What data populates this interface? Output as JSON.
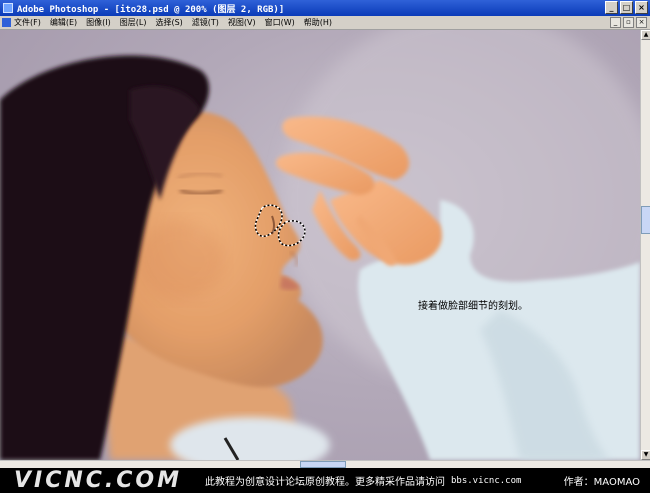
{
  "window": {
    "title": "Adobe Photoshop - [ito28.psd @ 200% (图层 2, RGB)]",
    "minimize": "_",
    "maximize": "□",
    "close": "×"
  },
  "menu": {
    "items": [
      "文件(F)",
      "编辑(E)",
      "图像(I)",
      "图层(L)",
      "选择(S)",
      "滤镜(T)",
      "视图(V)",
      "窗口(W)",
      "帮助(H)"
    ]
  },
  "canvas": {
    "caption": "接着做脸部细节的刻划。"
  },
  "footer": {
    "logo": "VICNC.COM",
    "description": "此教程为创意设计论坛原创教程。更多精采作品请访问",
    "url": "bbs.vicnc.com",
    "author": "作者：MAOMAO"
  },
  "colors": {
    "titlebar": "#0a3bb8",
    "background": "#b2a8b8",
    "hair": "#1a0c14",
    "skin": "#e8a26c",
    "sleeve": "#dce8ee"
  }
}
